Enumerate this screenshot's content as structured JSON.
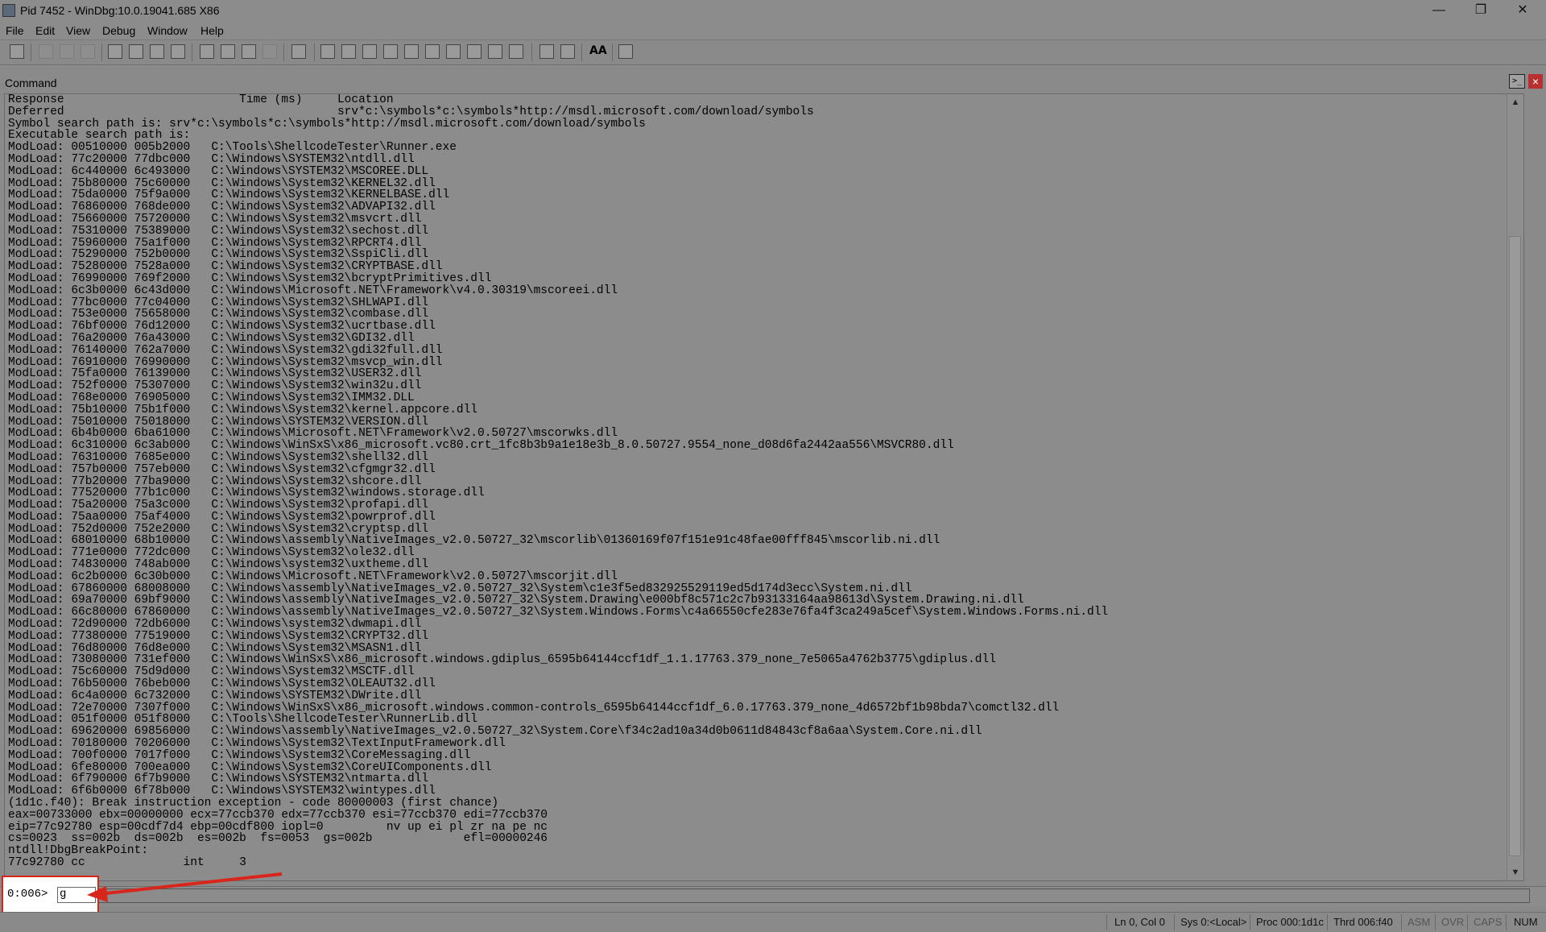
{
  "window": {
    "title": "Pid 7452 - WinDbg:10.0.19041.685 X86",
    "minimize": "—",
    "restore": "❐",
    "close": "✕"
  },
  "menu": [
    "File",
    "Edit",
    "View",
    "Debug",
    "Window",
    "Help"
  ],
  "toolbar": {
    "font_button": "AA",
    "icons": [
      "open-icon",
      "cut-icon",
      "copy-icon",
      "paste-icon",
      "go-icon",
      "restart-icon",
      "stop-debugging-icon",
      "detach-icon",
      "step-into-icon",
      "step-over-icon",
      "step-out-icon",
      "run-to-cursor-icon",
      "break-icon",
      "command-window-icon",
      "watch-icon",
      "locals-icon",
      "registers-icon",
      "memory-icon",
      "call-stack-icon",
      "disassembly-icon",
      "scratch-pad-icon",
      "source-mode-icon",
      "hex-status-icon",
      "font-icon",
      "options-icon"
    ]
  },
  "command_pane": {
    "label": "Command",
    "output_lines": [
      "Response                         Time (ms)     Location",
      "Deferred                                       srv*c:\\symbols*c:\\symbols*http://msdl.microsoft.com/download/symbols",
      "Symbol search path is: srv*c:\\symbols*c:\\symbols*http://msdl.microsoft.com/download/symbols",
      "Executable search path is:",
      "ModLoad: 00510000 005b2000   C:\\Tools\\ShellcodeTester\\Runner.exe",
      "ModLoad: 77c20000 77dbc000   C:\\Windows\\SYSTEM32\\ntdll.dll",
      "ModLoad: 6c440000 6c493000   C:\\Windows\\SYSTEM32\\MSCOREE.DLL",
      "ModLoad: 75b80000 75c60000   C:\\Windows\\System32\\KERNEL32.dll",
      "ModLoad: 75da0000 75f9a000   C:\\Windows\\System32\\KERNELBASE.dll",
      "ModLoad: 76860000 768de000   C:\\Windows\\System32\\ADVAPI32.dll",
      "ModLoad: 75660000 75720000   C:\\Windows\\System32\\msvcrt.dll",
      "ModLoad: 75310000 75389000   C:\\Windows\\System32\\sechost.dll",
      "ModLoad: 75960000 75a1f000   C:\\Windows\\System32\\RPCRT4.dll",
      "ModLoad: 75290000 752b0000   C:\\Windows\\System32\\SspiCli.dll",
      "ModLoad: 75280000 7528a000   C:\\Windows\\System32\\CRYPTBASE.dll",
      "ModLoad: 76990000 769f2000   C:\\Windows\\System32\\bcryptPrimitives.dll",
      "ModLoad: 6c3b0000 6c43d000   C:\\Windows\\Microsoft.NET\\Framework\\v4.0.30319\\mscoreei.dll",
      "ModLoad: 77bc0000 77c04000   C:\\Windows\\System32\\SHLWAPI.dll",
      "ModLoad: 753e0000 75658000   C:\\Windows\\System32\\combase.dll",
      "ModLoad: 76bf0000 76d12000   C:\\Windows\\System32\\ucrtbase.dll",
      "ModLoad: 76a20000 76a43000   C:\\Windows\\System32\\GDI32.dll",
      "ModLoad: 76140000 762a7000   C:\\Windows\\System32\\gdi32full.dll",
      "ModLoad: 76910000 76990000   C:\\Windows\\System32\\msvcp_win.dll",
      "ModLoad: 75fa0000 76139000   C:\\Windows\\System32\\USER32.dll",
      "ModLoad: 752f0000 75307000   C:\\Windows\\System32\\win32u.dll",
      "ModLoad: 768e0000 76905000   C:\\Windows\\System32\\IMM32.DLL",
      "ModLoad: 75b10000 75b1f000   C:\\Windows\\System32\\kernel.appcore.dll",
      "ModLoad: 75010000 75018000   C:\\Windows\\SYSTEM32\\VERSION.dll",
      "ModLoad: 6b4b0000 6ba61000   C:\\Windows\\Microsoft.NET\\Framework\\v2.0.50727\\mscorwks.dll",
      "ModLoad: 6c310000 6c3ab000   C:\\Windows\\WinSxS\\x86_microsoft.vc80.crt_1fc8b3b9a1e18e3b_8.0.50727.9554_none_d08d6fa2442aa556\\MSVCR80.dll",
      "ModLoad: 76310000 7685e000   C:\\Windows\\System32\\shell32.dll",
      "ModLoad: 757b0000 757eb000   C:\\Windows\\System32\\cfgmgr32.dll",
      "ModLoad: 77b20000 77ba9000   C:\\Windows\\System32\\shcore.dll",
      "ModLoad: 77520000 77b1c000   C:\\Windows\\System32\\windows.storage.dll",
      "ModLoad: 75a20000 75a3c000   C:\\Windows\\System32\\profapi.dll",
      "ModLoad: 75aa0000 75af4000   C:\\Windows\\System32\\powrprof.dll",
      "ModLoad: 752d0000 752e2000   C:\\Windows\\System32\\cryptsp.dll",
      "ModLoad: 68010000 68b10000   C:\\Windows\\assembly\\NativeImages_v2.0.50727_32\\mscorlib\\01360169f07f151e91c48fae00fff845\\mscorlib.ni.dll",
      "ModLoad: 771e0000 772dc000   C:\\Windows\\System32\\ole32.dll",
      "ModLoad: 74830000 748ab000   C:\\Windows\\system32\\uxtheme.dll",
      "ModLoad: 6c2b0000 6c30b000   C:\\Windows\\Microsoft.NET\\Framework\\v2.0.50727\\mscorjit.dll",
      "ModLoad: 67860000 68008000   C:\\Windows\\assembly\\NativeImages_v2.0.50727_32\\System\\c1e3f5ed832925529119ed5d174d3ecc\\System.ni.dll",
      "ModLoad: 69a70000 69bf9000   C:\\Windows\\assembly\\NativeImages_v2.0.50727_32\\System.Drawing\\e000bf8c571c2c7b93133164aa98613d\\System.Drawing.ni.dll",
      "ModLoad: 66c80000 67860000   C:\\Windows\\assembly\\NativeImages_v2.0.50727_32\\System.Windows.Forms\\c4a66550cfe283e76fa4f3ca249a5cef\\System.Windows.Forms.ni.dll",
      "ModLoad: 72d90000 72db6000   C:\\Windows\\system32\\dwmapi.dll",
      "ModLoad: 77380000 77519000   C:\\Windows\\System32\\CRYPT32.dll",
      "ModLoad: 76d80000 76d8e000   C:\\Windows\\System32\\MSASN1.dll",
      "ModLoad: 73080000 731ef000   C:\\Windows\\WinSxS\\x86_microsoft.windows.gdiplus_6595b64144ccf1df_1.1.17763.379_none_7e5065a4762b3775\\gdiplus.dll",
      "ModLoad: 75c60000 75d9d000   C:\\Windows\\System32\\MSCTF.dll",
      "ModLoad: 76b50000 76beb000   C:\\Windows\\System32\\OLEAUT32.dll",
      "ModLoad: 6c4a0000 6c732000   C:\\Windows\\SYSTEM32\\DWrite.dll",
      "ModLoad: 72e70000 7307f000   C:\\Windows\\WinSxS\\x86_microsoft.windows.common-controls_6595b64144ccf1df_6.0.17763.379_none_4d6572bf1b98bda7\\comctl32.dll",
      "ModLoad: 051f0000 051f8000   C:\\Tools\\ShellcodeTester\\RunnerLib.dll",
      "ModLoad: 69620000 69856000   C:\\Windows\\assembly\\NativeImages_v2.0.50727_32\\System.Core\\f34c2ad10a34d0b0611d84843cf8a6aa\\System.Core.ni.dll",
      "ModLoad: 70180000 70206000   C:\\Windows\\System32\\TextInputFramework.dll",
      "ModLoad: 700f0000 7017f000   C:\\Windows\\System32\\CoreMessaging.dll",
      "ModLoad: 6fe80000 700ea000   C:\\Windows\\System32\\CoreUIComponents.dll",
      "ModLoad: 6f790000 6f7b9000   C:\\Windows\\SYSTEM32\\ntmarta.dll",
      "ModLoad: 6f6b0000 6f78b000   C:\\Windows\\SYSTEM32\\wintypes.dll",
      "(1d1c.f40): Break instruction exception - code 80000003 (first chance)",
      "eax=00733000 ebx=00000000 ecx=77ccb370 edx=77ccb370 esi=77ccb370 edi=77ccb370",
      "eip=77c92780 esp=00cdf7d4 ebp=00cdf800 iopl=0         nv up ei pl zr na pe nc",
      "cs=0023  ss=002b  ds=002b  es=002b  fs=0053  gs=002b             efl=00000246",
      "ntdll!DbgBreakPoint:",
      "77c92780 cc              int     3"
    ]
  },
  "command_input": {
    "prompt": "0:006>",
    "value": "g"
  },
  "statusbar": {
    "ln_col": "Ln 0, Col 0",
    "sys": "Sys 0:<Local>",
    "proc": "Proc 000:1d1c",
    "thrd": "Thrd 006:f40",
    "asm": "ASM",
    "ovr": "OVR",
    "caps": "CAPS",
    "num": "NUM"
  },
  "colors": {
    "highlight": "#d8261a",
    "background": "#8c8c8c"
  }
}
